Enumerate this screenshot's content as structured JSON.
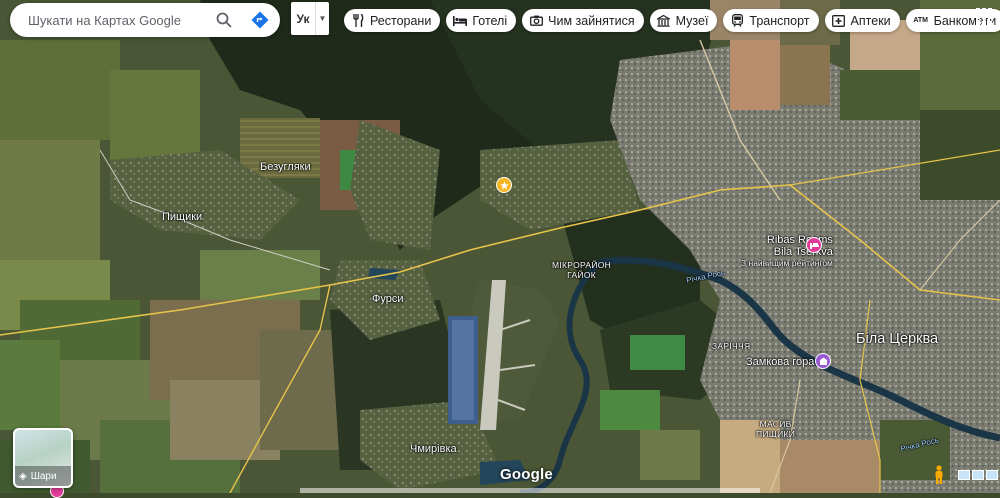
{
  "search": {
    "placeholder": "Шукати на Картах Google"
  },
  "layer_selector": {
    "code": "Ук"
  },
  "categories": [
    {
      "icon": "restaurant-icon",
      "label": "Ресторани"
    },
    {
      "icon": "hotel-icon",
      "label": "Готелі"
    },
    {
      "icon": "camera-icon",
      "label": "Чим зайнятися"
    },
    {
      "icon": "museum-icon",
      "label": "Музеї"
    },
    {
      "icon": "transit-icon",
      "label": "Транспорт"
    },
    {
      "icon": "pharmacy-icon",
      "label": "Аптеки"
    },
    {
      "icon": "atm-icon",
      "label": "Банкомати"
    }
  ],
  "map": {
    "type": "satellite",
    "places": {
      "pyshchyky": "Пищики",
      "bezuhliaky": "Безугляки",
      "fursy": "Фурси",
      "chmyrivka": "Чмирівка",
      "bila_tserkva": "Біла Церква",
      "hayok": "МІКРОРАЙОН\nГАЙОК",
      "zarichchia": "ЗАРІЧЧЯ",
      "masyv_pyshchyky": "МАСИВ\nПИЩИКИ",
      "river_label_1": "Річка Рось",
      "river_label_2": "Річка Рось"
    },
    "pois": {
      "ribas_name": "Ribas Rooms\nBila Tserkva",
      "ribas_sub": "З найвищим рейтингом",
      "zamkova": "Замкова гора"
    }
  },
  "layers_button": {
    "label": "Шари"
  },
  "branding": "Google"
}
